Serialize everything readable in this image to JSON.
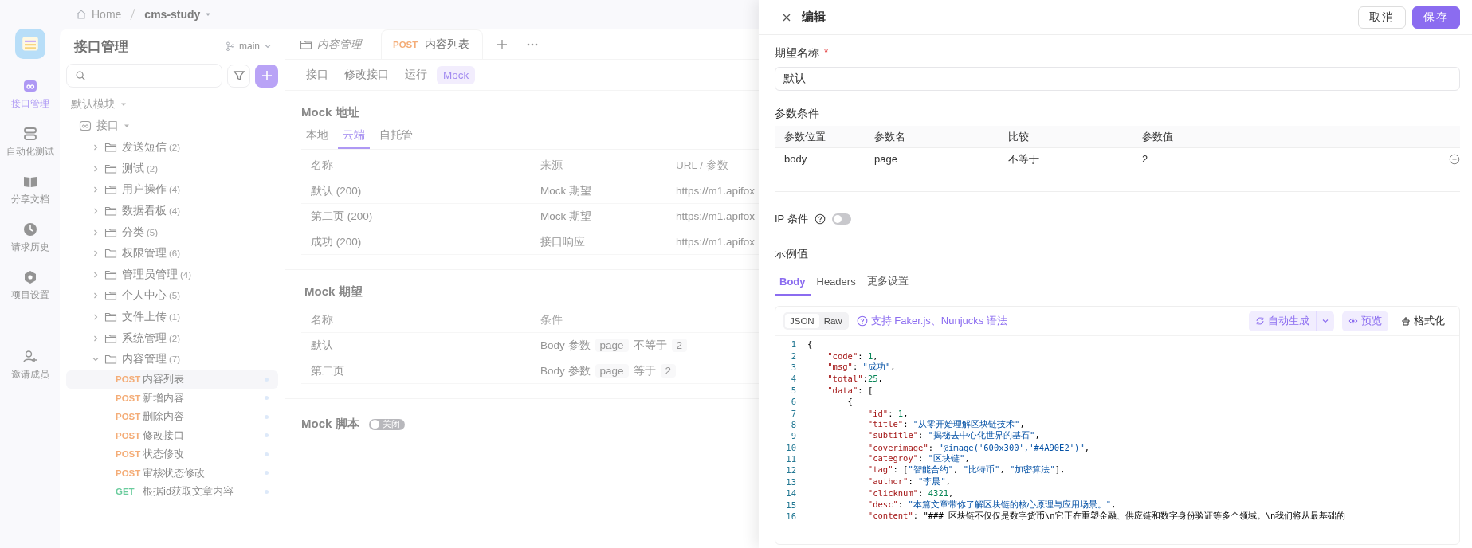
{
  "breadcrumb": {
    "home": "Home",
    "project": "cms-study"
  },
  "rail": [
    {
      "label": "接口管理",
      "kind": "api",
      "selected": true
    },
    {
      "label": "自动化测试",
      "kind": "tests",
      "selected": false
    },
    {
      "label": "分享文档",
      "kind": "docs",
      "selected": false
    },
    {
      "label": "请求历史",
      "kind": "history",
      "selected": false
    },
    {
      "label": "项目设置",
      "kind": "settings",
      "selected": false
    },
    {
      "label": "邀请成员",
      "kind": "invite",
      "selected": false
    }
  ],
  "tree_panel": {
    "title": "接口管理",
    "branch": "main",
    "module": "默认模块",
    "root": "接口",
    "folders": [
      {
        "name": "发送短信",
        "count": "(2)",
        "expanded": false
      },
      {
        "name": "测试",
        "count": "(2)",
        "expanded": false
      },
      {
        "name": "用户操作",
        "count": "(4)",
        "expanded": false
      },
      {
        "name": "数据看板",
        "count": "(4)",
        "expanded": false
      },
      {
        "name": "分类",
        "count": "(5)",
        "expanded": false
      },
      {
        "name": "权限管理",
        "count": "(6)",
        "expanded": false
      },
      {
        "name": "管理员管理",
        "count": "(4)",
        "expanded": false
      },
      {
        "name": "个人中心",
        "count": "(5)",
        "expanded": false
      },
      {
        "name": "文件上传",
        "count": "(1)",
        "expanded": false
      },
      {
        "name": "系统管理",
        "count": "(2)",
        "expanded": false
      },
      {
        "name": "内容管理",
        "count": "(7)",
        "expanded": true,
        "children": [
          {
            "method": "POST",
            "name": "内容列表",
            "selected": true
          },
          {
            "method": "POST",
            "name": "新增内容",
            "selected": false
          },
          {
            "method": "POST",
            "name": "删除内容",
            "selected": false
          },
          {
            "method": "POST",
            "name": "修改接口",
            "selected": false
          },
          {
            "method": "POST",
            "name": "状态修改",
            "selected": false
          },
          {
            "method": "POST",
            "name": "审核状态修改",
            "selected": false
          },
          {
            "method": "GET",
            "name": "根据id获取文章内容",
            "selected": false
          }
        ]
      }
    ]
  },
  "main": {
    "tabs": [
      {
        "kind": "folder",
        "label": "内容管理",
        "selected": false
      },
      {
        "kind": "request",
        "method": "POST",
        "label": "内容列表",
        "selected": true
      }
    ],
    "subtabs": [
      {
        "label": "接口",
        "selected": false
      },
      {
        "label": "修改接口",
        "selected": false
      },
      {
        "label": "运行",
        "selected": false
      },
      {
        "label": "Mock",
        "selected": true
      }
    ],
    "mock_address": {
      "title": "Mock 地址",
      "tabs": [
        {
          "label": "本地",
          "selected": false
        },
        {
          "label": "云端",
          "selected": true
        },
        {
          "label": "自托管",
          "selected": false
        }
      ],
      "columns": [
        "名称",
        "来源",
        "URL / 参数"
      ],
      "rows": [
        [
          "默认 (200)",
          "Mock 期望",
          "https://m1.apifox"
        ],
        [
          "第二页 (200)",
          "Mock 期望",
          "https://m1.apifox"
        ],
        [
          "成功 (200)",
          "接口响应",
          "https://m1.apifox"
        ]
      ]
    },
    "mock_expectations": {
      "title": "Mock 期望",
      "columns": [
        "名称",
        "条件"
      ],
      "rows": [
        {
          "name": "默认",
          "source": "Body 参数",
          "param": "page",
          "op": "不等于",
          "value": "2"
        },
        {
          "name": "第二页",
          "source": "Body 参数",
          "param": "page",
          "op": "等于",
          "value": "2"
        }
      ]
    },
    "mock_script": {
      "title": "Mock 脚本",
      "toggle_label": "关闭",
      "on": false
    }
  },
  "drawer": {
    "title": "编辑",
    "cancel": "取消",
    "save": "保存",
    "name_label": "期望名称",
    "required_mark": "*",
    "name_value": "默认",
    "conditions_label": "参数条件",
    "condition_columns": [
      "参数位置",
      "参数名",
      "比较",
      "参数值"
    ],
    "conditions": [
      [
        "body",
        "page",
        "不等于",
        "2"
      ]
    ],
    "ip_label": "IP 条件",
    "ip_on": false,
    "example_label": "示例值",
    "example_tabs": [
      {
        "label": "Body",
        "selected": true
      },
      {
        "label": "Headers",
        "selected": false
      },
      {
        "label": "更多设置",
        "selected": false
      }
    ],
    "format_tabs": [
      {
        "label": "JSON",
        "selected": true
      },
      {
        "label": "Raw",
        "selected": false
      }
    ],
    "syntax_link": "支持 Faker.js、Nunjucks 语法",
    "auto_generate": "自动生成",
    "preview": "预览",
    "format": "格式化",
    "code_lines": [
      {
        "num": "1",
        "text": "{"
      },
      {
        "num": "2",
        "text": "    \"code\": 1,"
      },
      {
        "num": "3",
        "text": "    \"msg\": \"成功\","
      },
      {
        "num": "4",
        "text": "    \"total\":25,"
      },
      {
        "num": "5",
        "text": "    \"data\": ["
      },
      {
        "num": "6",
        "text": "        {"
      },
      {
        "num": "7",
        "text": "            \"id\": 1,"
      },
      {
        "num": "8",
        "text": "            \"title\": \"从零开始理解区块链技术\","
      },
      {
        "num": "9",
        "text": "            \"subtitle\": \"揭秘去中心化世界的基石\","
      },
      {
        "num": "10",
        "text": "            \"coverimage\": \"@image('600x300','#4A90E2')\","
      },
      {
        "num": "11",
        "text": "            \"categroy\": \"区块链\","
      },
      {
        "num": "12",
        "text": "            \"tag\": [\"智能合约\", \"比特币\", \"加密算法\"],"
      },
      {
        "num": "13",
        "text": "            \"author\": \"李晨\","
      },
      {
        "num": "14",
        "text": "            \"clicknum\": 4321,"
      },
      {
        "num": "15",
        "text": "            \"desc\": \"本篇文章带你了解区块链的核心原理与应用场景。\","
      },
      {
        "num": "16",
        "text": "            \"content\": \"### 区块链不仅仅是数字货币\\n它正在重塑金融、供应链和数字身份验证等多个领域。\\n我们将从最基础的"
      }
    ]
  }
}
